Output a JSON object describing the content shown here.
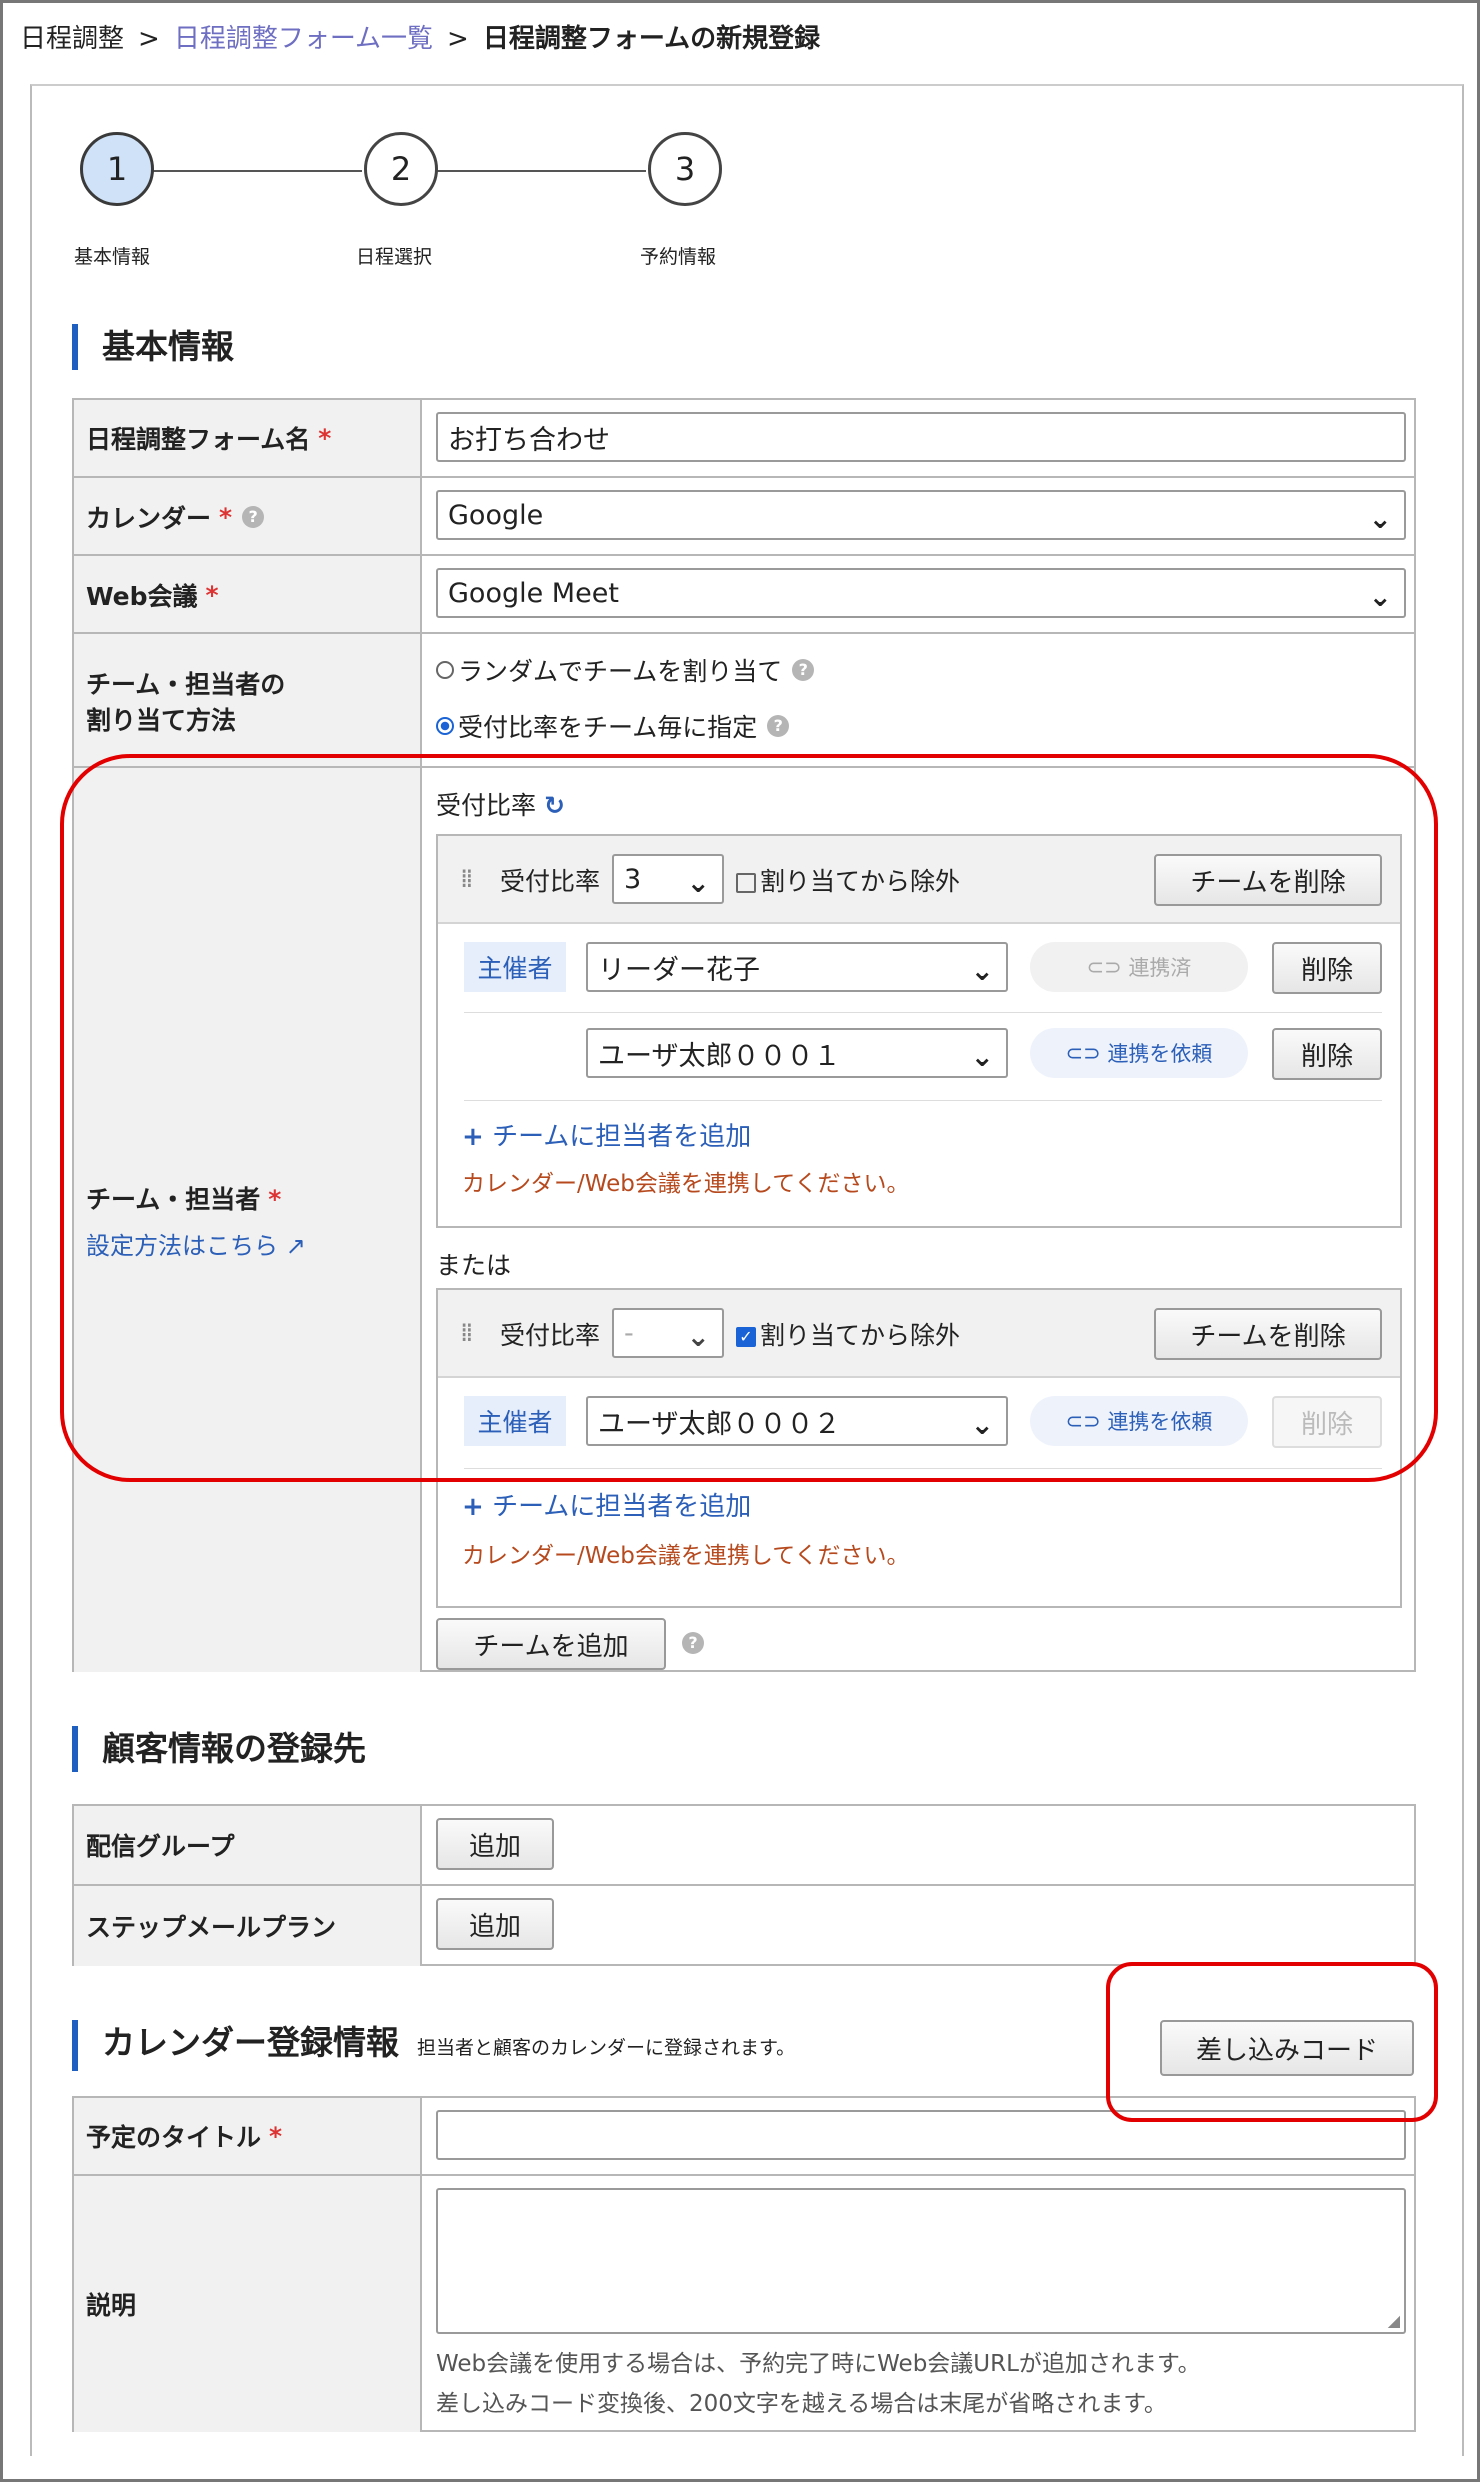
{
  "breadcrumb": {
    "root": "日程調整",
    "separator": ">",
    "list": "日程調整フォーム一覧",
    "current": "日程調整フォームの新規登録"
  },
  "steps": [
    {
      "num": "1",
      "label": "基本情報",
      "active": true
    },
    {
      "num": "2",
      "label": "日程選択",
      "active": false
    },
    {
      "num": "3",
      "label": "予約情報",
      "active": false
    }
  ],
  "sections": {
    "basic": "基本情報",
    "customer": "顧客情報の登録先",
    "calendar": "カレンダー登録情報",
    "calendar_note": "担当者と顧客のカレンダーに登録されます。"
  },
  "basic": {
    "form_name_label": "日程調整フォーム名",
    "form_name_value": "お打ち合わせ",
    "calendar_label": "カレンダー",
    "calendar_value": "Google",
    "webconf_label": "Web会議",
    "webconf_value": "Google Meet",
    "assign_label_1": "チーム・担当者の",
    "assign_label_2": "割り当て方法",
    "assign_option_random": "ランダムでチームを割り当て",
    "assign_option_ratio": "受付比率をチーム毎に指定",
    "team_label": "チーム・担当者",
    "team_help_link": "設定方法はこちら",
    "required_mark": "*"
  },
  "teams": {
    "ratio_heading": "受付比率",
    "ratio_label": "受付比率",
    "exclude_label": "割り当てから除外",
    "delete_team": "チームを削除",
    "organizer": "主催者",
    "delete": "削除",
    "add_member": "チームに担当者を追加",
    "warning": "カレンダー/Web会議を連携してください。",
    "or": "または",
    "add_team": "チームを追加",
    "team1": {
      "ratio": "3",
      "members": [
        {
          "name": "リーダー花子",
          "status": "連携済"
        },
        {
          "name": "ユーザ太郎０００１",
          "status": "連携を依頼"
        }
      ]
    },
    "team2": {
      "ratio": "-",
      "members": [
        {
          "name": "ユーザ太郎０００２",
          "status": "連携を依頼"
        }
      ]
    }
  },
  "customer": {
    "group_label": "配信グループ",
    "step_label": "ステップメールプラン",
    "add": "追加"
  },
  "calendar_info": {
    "insert_code": "差し込みコード",
    "title_label": "予定のタイトル",
    "desc_label": "説明",
    "note_1": "Web会議を使用する場合は、予約完了時にWeb会議URLが追加されます。",
    "note_2": "差し込みコード変換後、200文字を越える場合は末尾が省略されます。"
  },
  "colors": {
    "accent": "#1f5fbf",
    "highlight": "#e30000",
    "link": "#2c5fb8"
  }
}
